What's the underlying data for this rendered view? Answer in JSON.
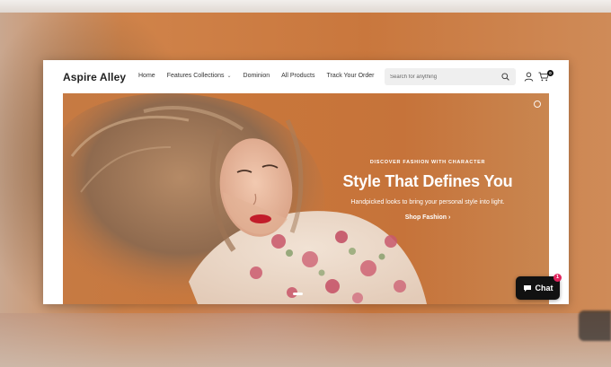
{
  "brand": {
    "name": "Aspire Alley"
  },
  "nav": {
    "items": [
      {
        "label": "Home"
      },
      {
        "label": "Features Collections",
        "has_dropdown": true
      },
      {
        "label": "Dominion"
      },
      {
        "label": "All Products"
      },
      {
        "label": "Track Your Order"
      }
    ]
  },
  "search": {
    "placeholder": "Search for anything",
    "icon": "search-icon"
  },
  "header_icons": {
    "account": "account-icon",
    "cart": "cart-icon",
    "cart_count": "0"
  },
  "hero": {
    "kicker": "DISCOVER FASHION WITH CHARACTER",
    "headline": "Style That Defines You",
    "subtext": "Handpicked looks to bring your personal style into light.",
    "cta": "Shop Fashion ›",
    "slide_count": 1,
    "active_slide": 1
  },
  "chat": {
    "label": "Chat",
    "badge": "1",
    "icon": "chat-bubble-icon"
  },
  "colors": {
    "hero_bg": "#c9773b",
    "chat_bg": "#111111",
    "badge": "#e0245e",
    "text_dark": "#222222"
  }
}
